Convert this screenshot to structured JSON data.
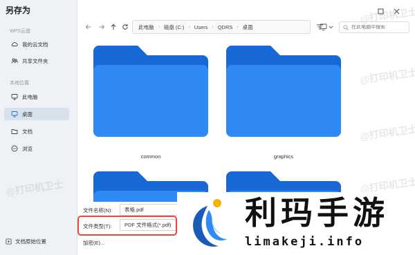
{
  "dialog": {
    "title": "另存为"
  },
  "sidebar": {
    "sections": [
      {
        "label": "WPS云盘",
        "items": [
          {
            "label": "我的云文档",
            "icon": "cloud-icon",
            "active": false
          },
          {
            "label": "共享文件夹",
            "icon": "shared-folder-icon",
            "active": false
          }
        ]
      },
      {
        "label": "本地位置",
        "items": [
          {
            "label": "此电脑",
            "icon": "computer-icon",
            "active": false
          },
          {
            "label": "桌面",
            "icon": "desktop-icon",
            "active": true
          },
          {
            "label": "文档",
            "icon": "folder-icon",
            "active": false
          },
          {
            "label": "浏览",
            "icon": "more-icon",
            "active": false
          }
        ]
      }
    ],
    "footer": {
      "label": "文档原始位置"
    }
  },
  "address": {
    "breadcrumbs": [
      "此电脑",
      "磁盘 (C:)",
      "Users",
      "QDRS",
      "桌面"
    ]
  },
  "search": {
    "placeholder": "在此电脑中搜索"
  },
  "folders": [
    {
      "name": "common"
    },
    {
      "name": "graphics"
    },
    {
      "name": ""
    },
    {
      "name": ""
    }
  ],
  "form": {
    "filename_label": "文件名称(N):",
    "filename_value": "表格.pdf",
    "filetype_label": "文件类型(T):",
    "filetype_value": "PDF 文件格式(*.pdf)",
    "encrypt_label": "加密(E)..."
  },
  "watermarks": [
    "@打印机卫士",
    "@打印机卫士",
    "@打印机卫士",
    "@打印机卫士",
    "@打印机卫士"
  ],
  "logo": {
    "title": "利玛手游",
    "subtitle": "limakeji.info"
  },
  "colors": {
    "accent": "#1a73e8",
    "folder_front": "#2f8af5",
    "folder_back": "#1868d8",
    "highlight": "#e8473a",
    "sidebar_bg": "#eef1f5"
  }
}
